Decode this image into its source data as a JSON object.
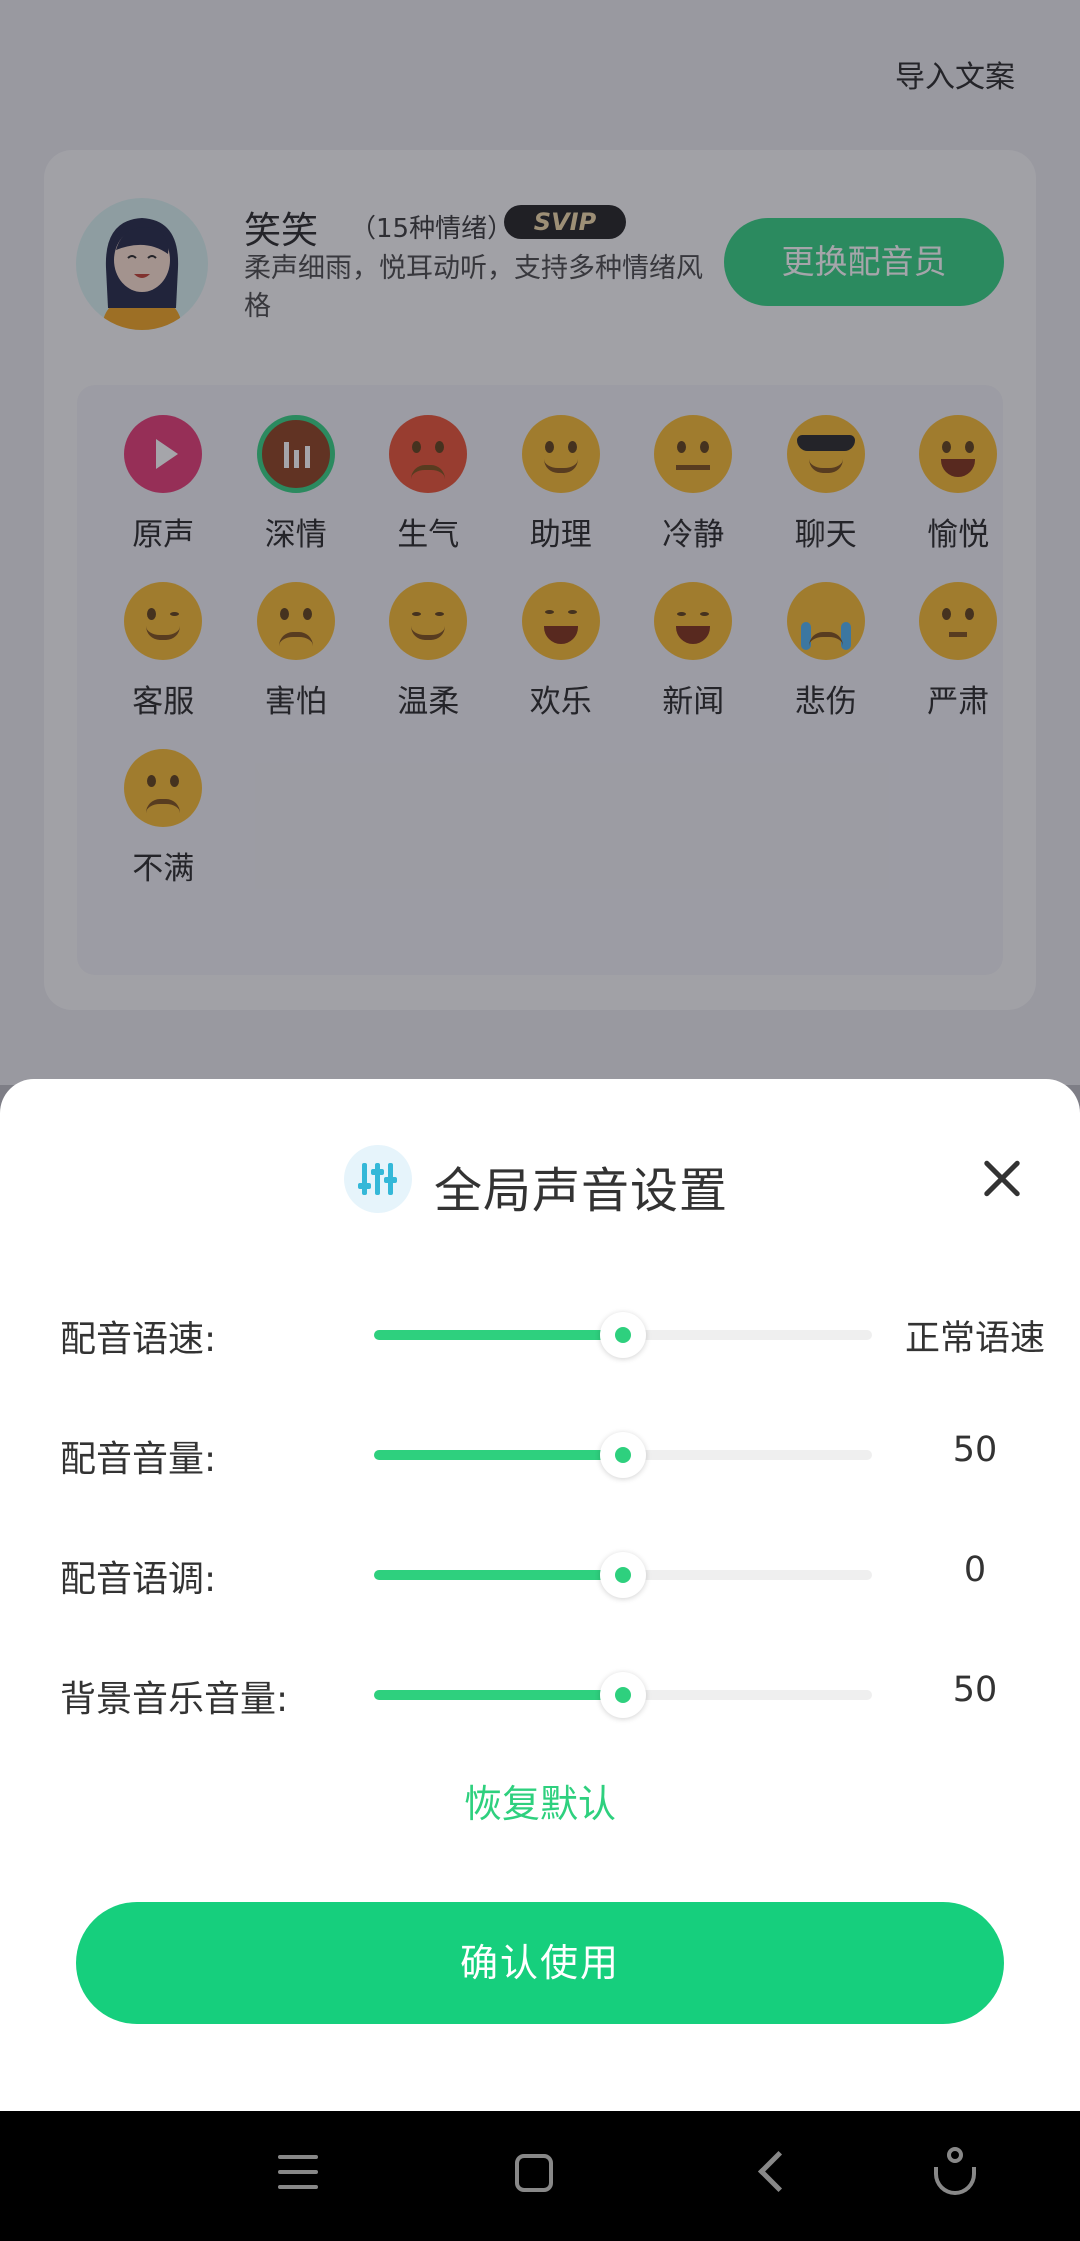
{
  "header": {
    "import_label": "导入文案"
  },
  "voice_card": {
    "name": "笑笑",
    "emotion_count": "（15种情绪）",
    "badge": "SVIP",
    "description": "柔声细雨，悦耳动听，支持多种情绪风格",
    "change_button": "更换配音员"
  },
  "emotions": [
    {
      "label": "原声",
      "icon": "play-icon"
    },
    {
      "label": "深情",
      "icon": "affectionate-emoji-icon",
      "selected": true
    },
    {
      "label": "生气",
      "icon": "angry-emoji-icon"
    },
    {
      "label": "助理",
      "icon": "assistant-emoji-icon"
    },
    {
      "label": "冷静",
      "icon": "calm-emoji-icon"
    },
    {
      "label": "聊天",
      "icon": "sunglasses-emoji-icon"
    },
    {
      "label": "愉悦",
      "icon": "joyful-emoji-icon"
    },
    {
      "label": "客服",
      "icon": "wink-emoji-icon"
    },
    {
      "label": "害怕",
      "icon": "scared-emoji-icon"
    },
    {
      "label": "温柔",
      "icon": "gentle-emoji-icon"
    },
    {
      "label": "欢乐",
      "icon": "laughing-emoji-icon"
    },
    {
      "label": "新闻",
      "icon": "smile-emoji-icon"
    },
    {
      "label": "悲伤",
      "icon": "crying-emoji-icon"
    },
    {
      "label": "严肃",
      "icon": "serious-emoji-icon"
    },
    {
      "label": "不满",
      "icon": "frown-emoji-icon"
    }
  ],
  "sheet": {
    "title": "全局声音设置",
    "rows": [
      {
        "label": "配音语速:",
        "value": "正常语速",
        "level": 0.5
      },
      {
        "label": "配音音量:",
        "value": "50",
        "level": 0.5
      },
      {
        "label": "配音语调:",
        "value": "0",
        "level": 0.5
      },
      {
        "label": "背景音乐音量:",
        "value": "50",
        "level": 0.5
      }
    ],
    "reset_label": "恢复默认",
    "confirm_label": "确认使用"
  },
  "colors": {
    "accent": "#16cf7d",
    "svip_bg": "#1a1a1a"
  }
}
